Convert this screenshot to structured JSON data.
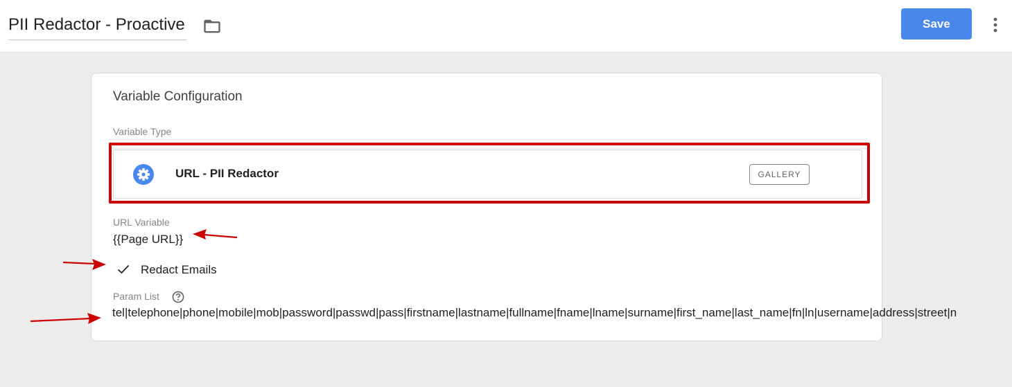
{
  "header": {
    "title": "PII Redactor - Proactive",
    "save_label": "Save",
    "folder_icon": "folder-icon",
    "more_icon": "more-vert-icon",
    "save_color": "#4a87ea"
  },
  "card": {
    "title": "Variable Configuration",
    "variable_type_label": "Variable Type",
    "variable_type": {
      "name": "URL - PII Redactor",
      "icon": "gear-icon",
      "badge": "GALLERY"
    },
    "url_variable_label": "URL Variable",
    "url_variable_value": "{{Page URL}}",
    "redact_emails": {
      "label": "Redact Emails",
      "checked": true
    },
    "param_list_label": "Param List",
    "param_list_value": "tel|telephone|phone|mobile|mob|password|passwd|pass|firstname|lastname|fullname|fname|lname|surname|first_name|last_name|fn|ln|username|address|street|n"
  },
  "annotations": {
    "highlight_color": "#cc0000",
    "arrow_color": "#cc0000"
  }
}
